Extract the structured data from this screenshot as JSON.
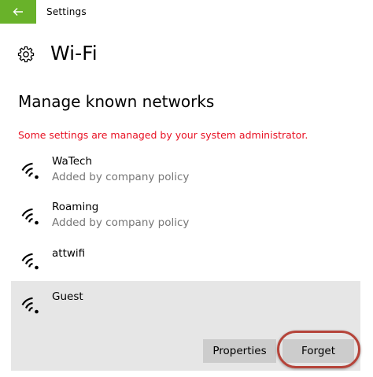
{
  "window": {
    "title": "Settings"
  },
  "page": {
    "title": "Wi-Fi",
    "section_title": "Manage known networks",
    "admin_message": "Some settings are managed by your system administrator."
  },
  "networks": [
    {
      "name": "WaTech",
      "subtitle": "Added by company policy"
    },
    {
      "name": "Roaming",
      "subtitle": "Added by company policy"
    },
    {
      "name": "attwifi",
      "subtitle": ""
    },
    {
      "name": "Guest",
      "subtitle": ""
    }
  ],
  "selected_network": {
    "properties_label": "Properties",
    "forget_label": "Forget"
  },
  "colors": {
    "accent_green": "#69b22a",
    "warning_red": "#e81123",
    "selection_gray": "#e6e6e6",
    "button_gray": "#cccccc",
    "highlight_ring": "#b5443a"
  },
  "icons": {
    "back": "back-arrow-icon",
    "settings": "gear-icon",
    "network": "wifi-signal-icon"
  }
}
